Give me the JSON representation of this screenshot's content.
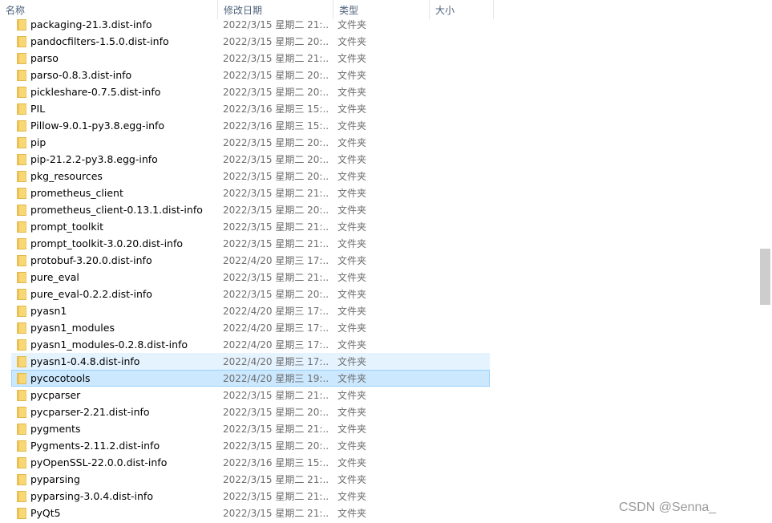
{
  "columns": {
    "name": "名称",
    "date": "修改日期",
    "type": "类型",
    "size": "大小"
  },
  "sort_indicator": "^",
  "files": [
    {
      "name": "packaging-21.3.dist-info",
      "date": "2022/3/15 星期二 21:...",
      "type": "文件夹"
    },
    {
      "name": "pandocfilters-1.5.0.dist-info",
      "date": "2022/3/15 星期二 20:...",
      "type": "文件夹"
    },
    {
      "name": "parso",
      "date": "2022/3/15 星期二 21:...",
      "type": "文件夹"
    },
    {
      "name": "parso-0.8.3.dist-info",
      "date": "2022/3/15 星期二 20:...",
      "type": "文件夹"
    },
    {
      "name": "pickleshare-0.7.5.dist-info",
      "date": "2022/3/15 星期二 20:...",
      "type": "文件夹"
    },
    {
      "name": "PIL",
      "date": "2022/3/16 星期三 15:...",
      "type": "文件夹"
    },
    {
      "name": "Pillow-9.0.1-py3.8.egg-info",
      "date": "2022/3/16 星期三 15:...",
      "type": "文件夹"
    },
    {
      "name": "pip",
      "date": "2022/3/15 星期二 20:...",
      "type": "文件夹"
    },
    {
      "name": "pip-21.2.2-py3.8.egg-info",
      "date": "2022/3/15 星期二 20:...",
      "type": "文件夹"
    },
    {
      "name": "pkg_resources",
      "date": "2022/3/15 星期二 20:...",
      "type": "文件夹"
    },
    {
      "name": "prometheus_client",
      "date": "2022/3/15 星期二 21:...",
      "type": "文件夹"
    },
    {
      "name": "prometheus_client-0.13.1.dist-info",
      "date": "2022/3/15 星期二 20:...",
      "type": "文件夹"
    },
    {
      "name": "prompt_toolkit",
      "date": "2022/3/15 星期二 21:...",
      "type": "文件夹"
    },
    {
      "name": "prompt_toolkit-3.0.20.dist-info",
      "date": "2022/3/15 星期二 21:...",
      "type": "文件夹"
    },
    {
      "name": "protobuf-3.20.0.dist-info",
      "date": "2022/4/20 星期三 17:...",
      "type": "文件夹"
    },
    {
      "name": "pure_eval",
      "date": "2022/3/15 星期二 21:...",
      "type": "文件夹"
    },
    {
      "name": "pure_eval-0.2.2.dist-info",
      "date": "2022/3/15 星期二 20:...",
      "type": "文件夹"
    },
    {
      "name": "pyasn1",
      "date": "2022/4/20 星期三 17:...",
      "type": "文件夹"
    },
    {
      "name": "pyasn1_modules",
      "date": "2022/4/20 星期三 17:...",
      "type": "文件夹"
    },
    {
      "name": "pyasn1_modules-0.2.8.dist-info",
      "date": "2022/4/20 星期三 17:...",
      "type": "文件夹"
    },
    {
      "name": "pyasn1-0.4.8.dist-info",
      "date": "2022/4/20 星期三 17:...",
      "type": "文件夹",
      "state": "hover"
    },
    {
      "name": "pycocotools",
      "date": "2022/4/20 星期三 19:...",
      "type": "文件夹",
      "state": "selected"
    },
    {
      "name": "pycparser",
      "date": "2022/3/15 星期二 21:...",
      "type": "文件夹"
    },
    {
      "name": "pycparser-2.21.dist-info",
      "date": "2022/3/15 星期二 20:...",
      "type": "文件夹"
    },
    {
      "name": "pygments",
      "date": "2022/3/15 星期二 21:...",
      "type": "文件夹"
    },
    {
      "name": "Pygments-2.11.2.dist-info",
      "date": "2022/3/15 星期二 20:...",
      "type": "文件夹"
    },
    {
      "name": "pyOpenSSL-22.0.0.dist-info",
      "date": "2022/3/16 星期三 15:...",
      "type": "文件夹"
    },
    {
      "name": "pyparsing",
      "date": "2022/3/15 星期二 21:...",
      "type": "文件夹"
    },
    {
      "name": "pyparsing-3.0.4.dist-info",
      "date": "2022/3/15 星期二 21:...",
      "type": "文件夹"
    },
    {
      "name": "PyQt5",
      "date": "2022/3/15 星期二 21:...",
      "type": "文件夹"
    }
  ],
  "colors": {
    "header_text": "#4c607a",
    "hover_bg": "#e5f3ff",
    "selected_bg": "#cce8ff",
    "selected_border": "#99d1ff",
    "folder": "#f8d775"
  },
  "icons": {
    "folder": "folder-icon"
  },
  "watermark": "CSDN @Senna_"
}
